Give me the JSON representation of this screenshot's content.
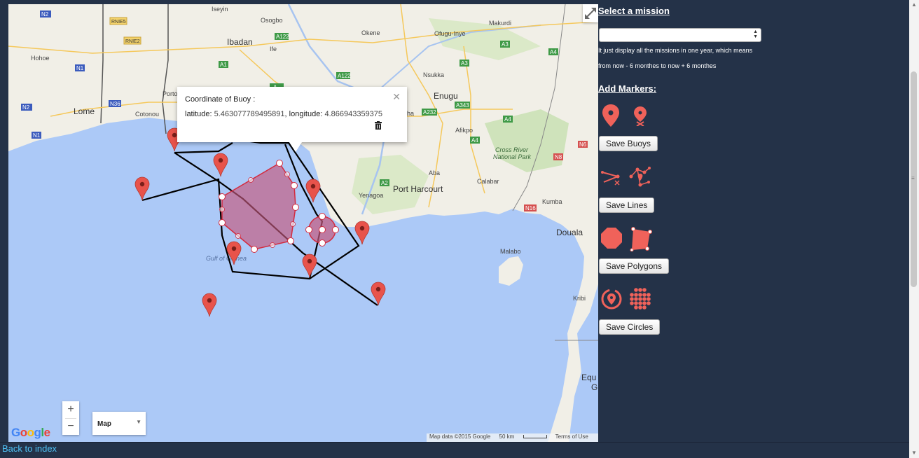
{
  "map": {
    "places": {
      "iseyin": "Iseyin",
      "osogbo": "Osogbo",
      "ibadan": "Ibadan",
      "ife": "Ife",
      "okene": "Okene",
      "ofugu_inye": "Ofugu-Inye",
      "makurdi": "Makurdi",
      "hohoe": "Hohoe",
      "nsukka": "Nsukka",
      "porto": "Porto N",
      "lome": "Lome",
      "cotonou": "Cotonou",
      "enugu": "Enugu",
      "afikpo": "Afikpo",
      "cross_river": "Cross River",
      "national_park": "National Park",
      "aba": "Aba",
      "yenagoa": "Yenagoa",
      "port_harcourt": "Port Harcourt",
      "calabar": "Calabar",
      "kumba": "Kumba",
      "douala": "Douala",
      "malabo": "Malabo",
      "kribi": "Kribi",
      "gulf": "Gulf of Guinea",
      "equ": "Equ",
      "g": "G",
      "cha": "ha"
    },
    "roads": [
      "N2",
      "RNIE5",
      "RNIE2",
      "N1",
      "N2",
      "N36",
      "N1",
      "A122",
      "A1",
      "A122",
      "A1",
      "A2",
      "A3",
      "A4",
      "A232",
      "A343",
      "A3",
      "A4",
      "A4",
      "A2",
      "N6",
      "N8",
      "N16",
      "A"
    ],
    "info_window": {
      "title": "Coordinate of Buoy :",
      "lat_label": "latitude:",
      "lat_value": "5.463077789495891",
      "lng_label": "longitude:",
      "lng_value": "4.866943359375",
      "close_icon": "close-icon",
      "delete_icon": "trash-icon"
    },
    "zoom_in": "+",
    "zoom_out": "−",
    "map_type": "Map",
    "logo": "Google",
    "attribution": {
      "data": "Map data ©2015 Google",
      "scale": "50 km",
      "terms": "Terms of Use"
    },
    "colors": {
      "marker": "#e8534b",
      "polygon_fill": "#c4587d",
      "polygon_stroke": "#d32b3f",
      "polyline": "#000000",
      "water": "#acc9f7",
      "land": "#f1efe7"
    }
  },
  "panel": {
    "select_heading": "Select a mission",
    "select_value": "",
    "note_line1": "It just display all the missions in one year, which means",
    "note_line2": "from now - 6 monthes to now + 6 monthes",
    "add_heading": "Add Markers:",
    "save_buoys": "Save Buoys",
    "save_lines": "Save Lines",
    "save_polygons": "Save Polygons",
    "save_circles": "Save Circles",
    "tool_icons": [
      "marker-icon",
      "marker-remove-icon",
      "line-draw-icon",
      "line-edit-icon",
      "octagon-icon",
      "polygon-edit-icon",
      "circle-draw-icon",
      "circle-edit-icon"
    ],
    "accent": "#f0625a"
  },
  "back_link": "Back to index"
}
